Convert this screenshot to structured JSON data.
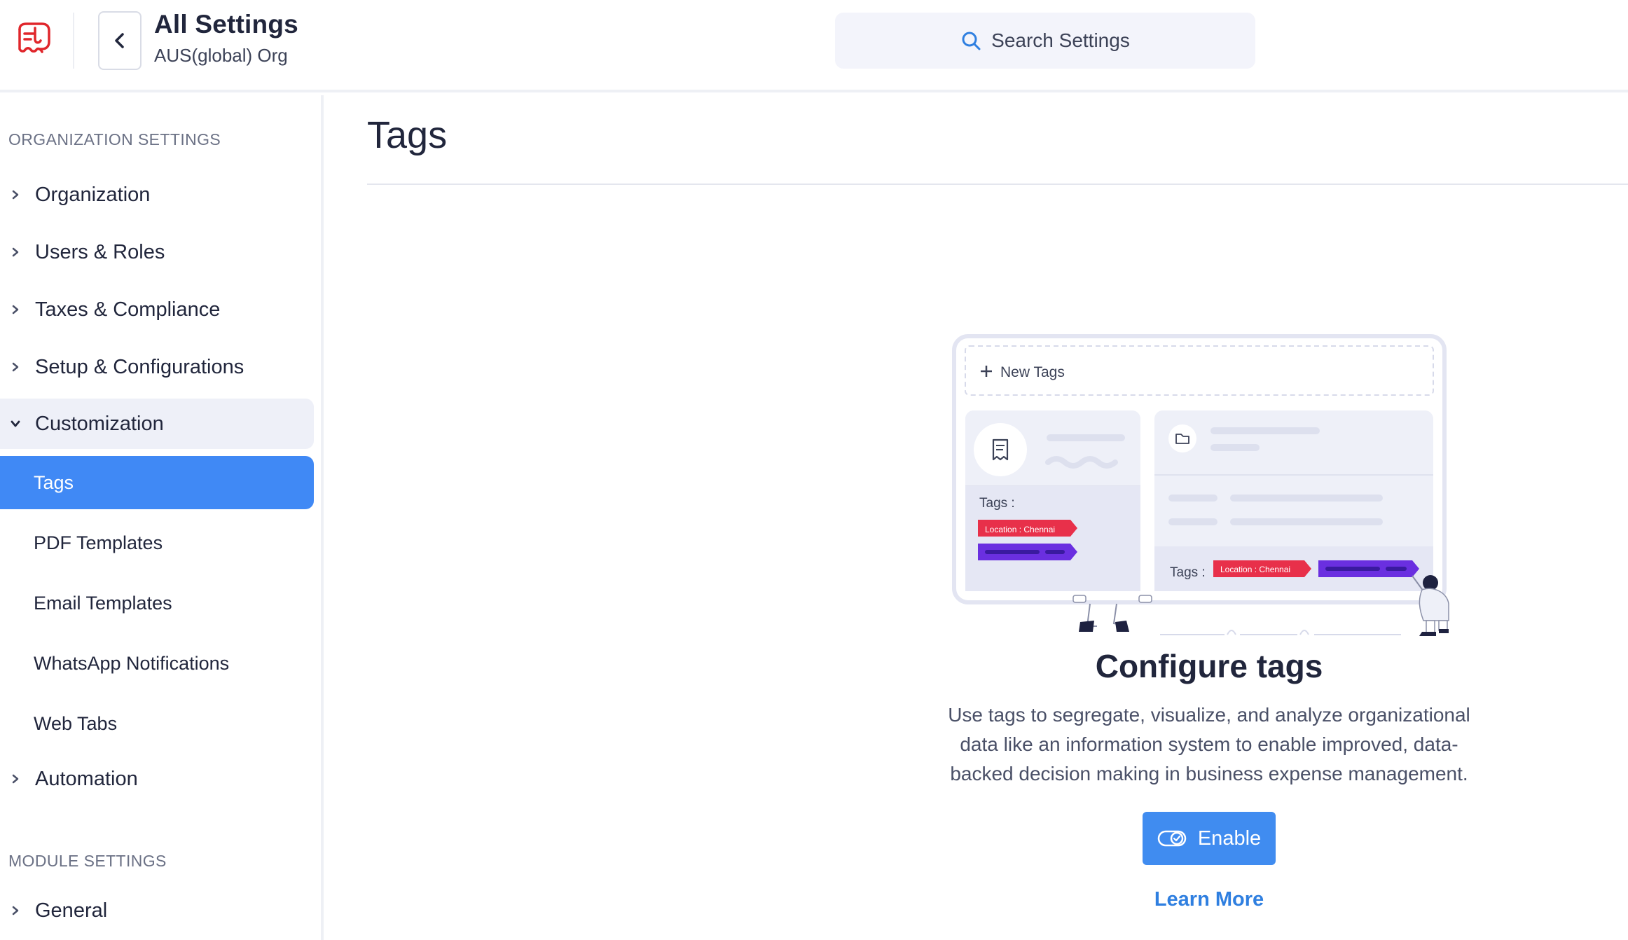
{
  "header": {
    "title": "All Settings",
    "subtitle": "AUS(global) Org",
    "search_placeholder": "Search Settings"
  },
  "sidebar": {
    "org_section_label": "ORGANIZATION SETTINGS",
    "items": [
      {
        "label": "Organization"
      },
      {
        "label": "Users & Roles"
      },
      {
        "label": "Taxes & Compliance"
      },
      {
        "label": "Setup & Configurations"
      },
      {
        "label": "Customization"
      },
      {
        "label": "Automation"
      }
    ],
    "customization_children": [
      {
        "label": "Tags",
        "active": true
      },
      {
        "label": "PDF Templates"
      },
      {
        "label": "Email Templates"
      },
      {
        "label": "WhatsApp Notifications"
      },
      {
        "label": "Web Tabs"
      }
    ],
    "module_section_label": "MODULE SETTINGS",
    "module_items": [
      {
        "label": "General"
      }
    ]
  },
  "main": {
    "page_title": "Tags",
    "illustration": {
      "new_tags": "New Tags",
      "tags_label": "Tags :",
      "tag_chip": "Location : Chennai"
    },
    "configure_title": "Configure tags",
    "configure_desc_lines": [
      "Use tags to segregate, visualize, and analyze organizational",
      "data like an information system to enable improved, data-",
      "backed decision making in business expense management."
    ],
    "enable_label": "Enable",
    "learn_more_label": "Learn More"
  },
  "colors": {
    "accent": "#408cf0",
    "active_nav": "#4089f5",
    "brand_red": "#e0262b",
    "tag_red": "#e8304a",
    "tag_purple": "#6a2fe0"
  }
}
